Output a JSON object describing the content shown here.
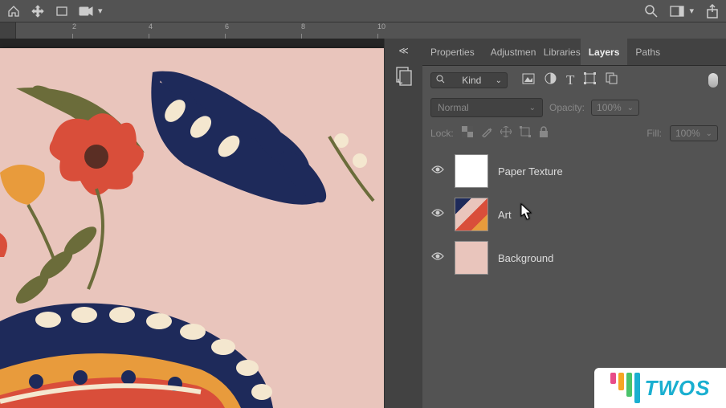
{
  "toolbar": {
    "ruler_marks": [
      "2",
      "4",
      "6",
      "8",
      "10"
    ]
  },
  "panel": {
    "tabs": [
      "Properties",
      "Adjustments",
      "Libraries",
      "Layers",
      "Paths"
    ],
    "active_tab": 3,
    "kind_filter": "Kind",
    "blend_mode": "Normal",
    "opacity_label": "Opacity:",
    "opacity_value": "100%",
    "lock_label": "Lock:",
    "fill_label": "Fill:",
    "fill_value": "100%",
    "layers": [
      {
        "name": "Paper Texture",
        "thumb": "white"
      },
      {
        "name": "Art",
        "thumb": "art"
      },
      {
        "name": "Background",
        "thumb": "pink"
      }
    ]
  },
  "watermark": {
    "text": "TWOS"
  }
}
